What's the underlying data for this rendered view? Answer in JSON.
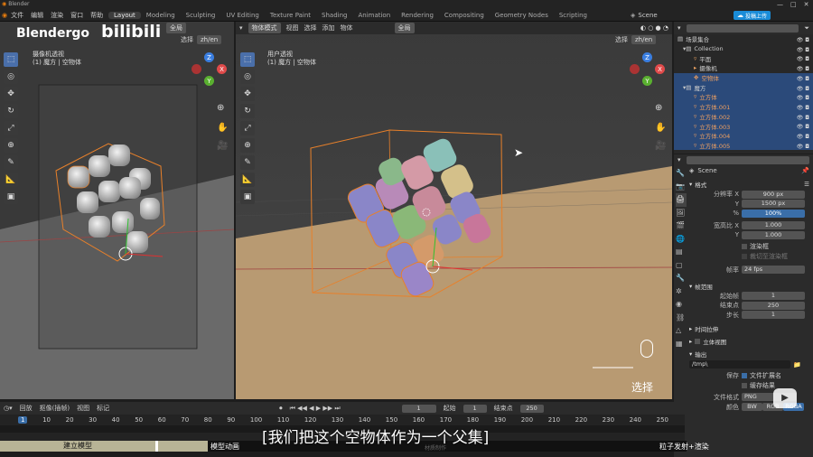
{
  "app_title": "Blender",
  "menus": [
    "文件",
    "编辑",
    "渲染",
    "窗口",
    "帮助"
  ],
  "workspaces": [
    "Layout",
    "Modeling",
    "Sculpting",
    "UV Editing",
    "Texture Paint",
    "Shading",
    "Animation",
    "Rendering",
    "Compositing",
    "Geometry Nodes",
    "Scripting"
  ],
  "scene_name": "Scene",
  "upload_label": "投稿上传",
  "watermark": "Blendergo",
  "watermark2": "bilibili",
  "left_vp": {
    "view_name": "摄像机透视",
    "subtitle": "(1) 魔方 | 空物体",
    "global": "全局",
    "select": "选择",
    "lang": "zh/en"
  },
  "right_vp": {
    "mode": "物体模式",
    "menus": [
      "视图",
      "选择",
      "添加",
      "物体"
    ],
    "view_name": "用户透视",
    "subtitle": "(1) 魔方 | 空物体",
    "global": "全局",
    "select": "选择",
    "lang": "zh/en",
    "action_hint": "选择"
  },
  "outliner": {
    "items": [
      "场景集合",
      "Collection",
      "平面",
      "摄像机",
      "空物体",
      "魔方",
      "立方体",
      "立方体.001",
      "立方体.002",
      "立方体.003",
      "立方体.004",
      "立方体.005"
    ]
  },
  "properties": {
    "scene": "Scene",
    "format": "格式",
    "res_x_label": "分辨率 X",
    "res_x": "900 px",
    "res_y_label": "Y",
    "res_y": "1500 px",
    "pct_label": "%",
    "pct": "100%",
    "aspect_x_label": "宽高比 X",
    "aspect_x": "1.000",
    "aspect_y_label": "Y",
    "aspect_y": "1.000",
    "render_region": "渲染框",
    "crop": "裁切至渲染框",
    "fps_label": "帧率",
    "fps": "24 fps",
    "frame_range": "帧范围",
    "start_label": "起始帧",
    "start": "1",
    "end_label": "结束点",
    "end": "250",
    "step_label": "步长",
    "step": "1",
    "time_remap": "时间拉伸",
    "stereo": "立体视图",
    "output": "输出",
    "path": "/tmp\\",
    "save_label": "保存",
    "file_ext": "文件扩展名",
    "cache": "缓存结果",
    "file_format_label": "文件格式",
    "file_format": "PNG",
    "color_label": "颜色",
    "bw": "BW",
    "rgb": "RGB",
    "rgba": "RGBA"
  },
  "timeline": {
    "menus": [
      "回放",
      "抠像(插帧)",
      "视图",
      "标记"
    ],
    "current": "1",
    "start_label": "起始",
    "start": "1",
    "end_label": "结束点",
    "end": "250",
    "ticks": [
      "1",
      "10",
      "20",
      "30",
      "40",
      "50",
      "60",
      "70",
      "80",
      "90",
      "100",
      "110",
      "120",
      "130",
      "140",
      "150",
      "160",
      "170",
      "180",
      "190",
      "200",
      "210",
      "220",
      "230",
      "240",
      "250"
    ]
  },
  "chapters": [
    "建立模型",
    "模型动画",
    "粒子发射+渲染"
  ],
  "chapter_faded": "材质制作",
  "subtitle": "[我们把这个空物体作为一个父集]"
}
